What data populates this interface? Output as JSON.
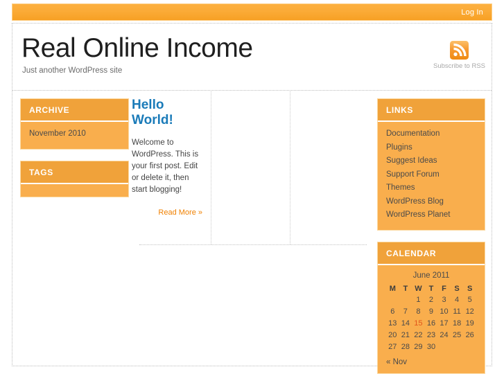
{
  "topbar": {
    "login_label": "Log In"
  },
  "header": {
    "site_title": "Real Online Income",
    "site_description": "Just another WordPress site",
    "rss_label": "Subscribe to RSS",
    "rss_icon": "rss-icon"
  },
  "colors": {
    "accent_orange": "#f9ae4d",
    "title_bar_orange": "#f0a23a",
    "link_blue": "#1a7bb9",
    "read_more_orange": "#f08000",
    "today_red": "#e2551b"
  },
  "left_sidebar": {
    "widgets": [
      {
        "title": "ARCHIVE",
        "items": [
          "November 2010"
        ]
      },
      {
        "title": "TAGS",
        "items": []
      }
    ]
  },
  "post": {
    "title": "Hello World!",
    "body": "Welcome to WordPress. This is your first post. Edit or delete it, then start blogging!",
    "read_more_label": "Read More »"
  },
  "right_sidebar": {
    "links_widget": {
      "title": "LINKS",
      "items": [
        "Documentation",
        "Plugins",
        "Suggest Ideas",
        "Support Forum",
        "Themes",
        "WordPress Blog",
        "WordPress Planet"
      ]
    },
    "calendar_widget": {
      "title": "CALENDAR",
      "caption": "June 2011",
      "weekdays": [
        "M",
        "T",
        "W",
        "T",
        "F",
        "S",
        "S"
      ],
      "weeks": [
        [
          "",
          "",
          "1",
          "2",
          "3",
          "4",
          "5"
        ],
        [
          "6",
          "7",
          "8",
          "9",
          "10",
          "11",
          "12"
        ],
        [
          "13",
          "14",
          "15",
          "16",
          "17",
          "18",
          "19"
        ],
        [
          "20",
          "21",
          "22",
          "23",
          "24",
          "25",
          "26"
        ],
        [
          "27",
          "28",
          "29",
          "30",
          "",
          "",
          ""
        ]
      ],
      "today": "15",
      "prev_label": "« Nov"
    }
  }
}
